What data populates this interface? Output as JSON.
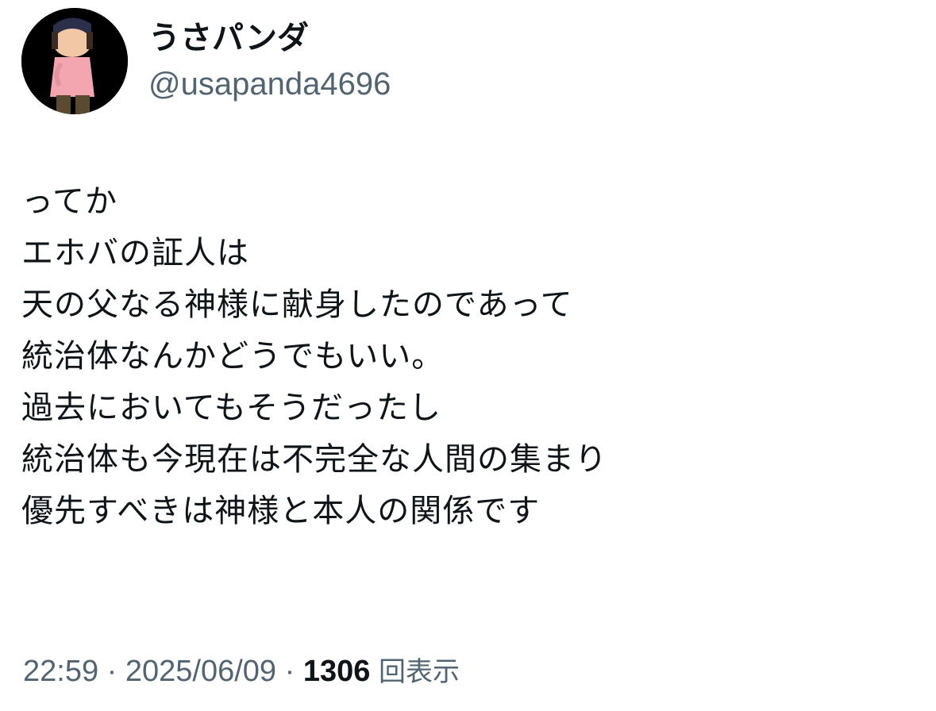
{
  "author": {
    "display_name": "うさパンダ",
    "handle": "@usapanda4696",
    "avatar": "avatar-cartoon-person-icon"
  },
  "tweet": {
    "lines": [
      "ってか",
      "エホバの証人は",
      "天の父なる神様に献身したのであって",
      "統治体なんかどうでもいい。",
      "過去においてもそうだったし",
      "統治体も今現在は不完全な人間の集まり",
      "優先すべきは神様と本人の関係です"
    ]
  },
  "meta": {
    "time": "22:59",
    "separator": " · ",
    "date": "2025/06/09",
    "views_count": "1306",
    "views_label": "回表示"
  },
  "colors": {
    "text": "#0f1419",
    "secondary": "#536471",
    "background": "#ffffff"
  }
}
